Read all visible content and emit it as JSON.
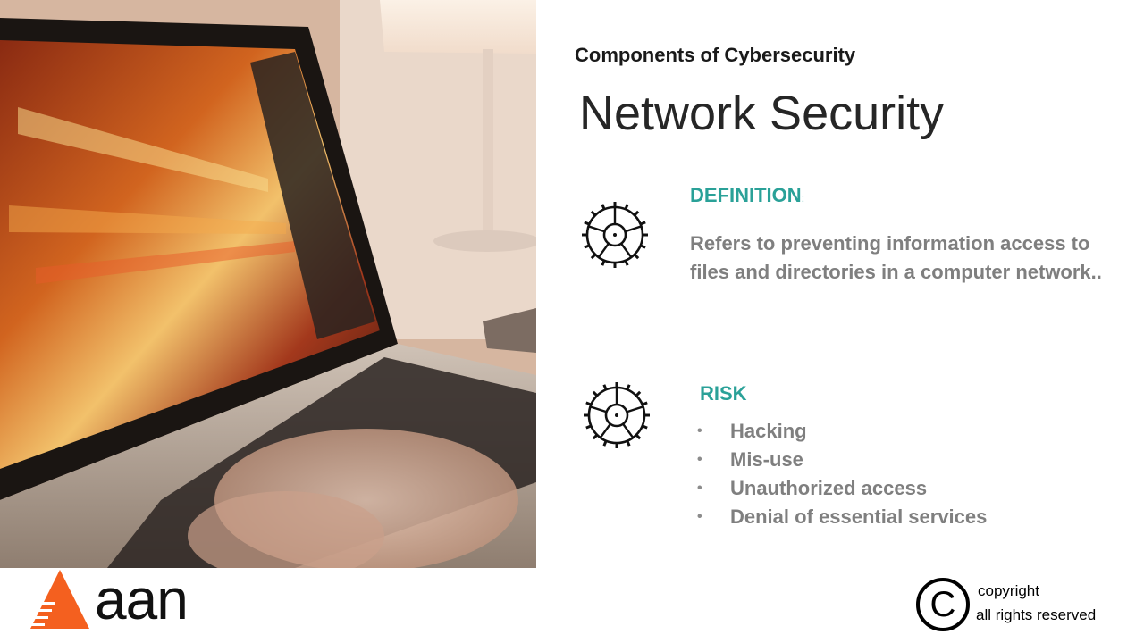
{
  "slide": {
    "subtitle": "Components of Cybersecurity",
    "title": "Network Security"
  },
  "definition": {
    "heading": "DEFINITION",
    "heading_suffix": ":",
    "text": "Refers to preventing information access to files and directories in a computer network.."
  },
  "risk": {
    "heading": "RISK",
    "bullet": "•",
    "items": [
      "Hacking",
      "Mis-use",
      "Unauthorized access",
      "Denial of essential services"
    ]
  },
  "footer": {
    "brand": "aan",
    "copyright_line1": "copyright",
    "copyright_line2": "all rights reserved",
    "copyright_symbol": "C"
  },
  "colors": {
    "accent": "#2aa198",
    "body_text": "#7f7f7f",
    "logo_orange": "#f4601f"
  },
  "icons": [
    "laptop-photo",
    "gear-icon",
    "copyright-icon",
    "brand-logo"
  ]
}
